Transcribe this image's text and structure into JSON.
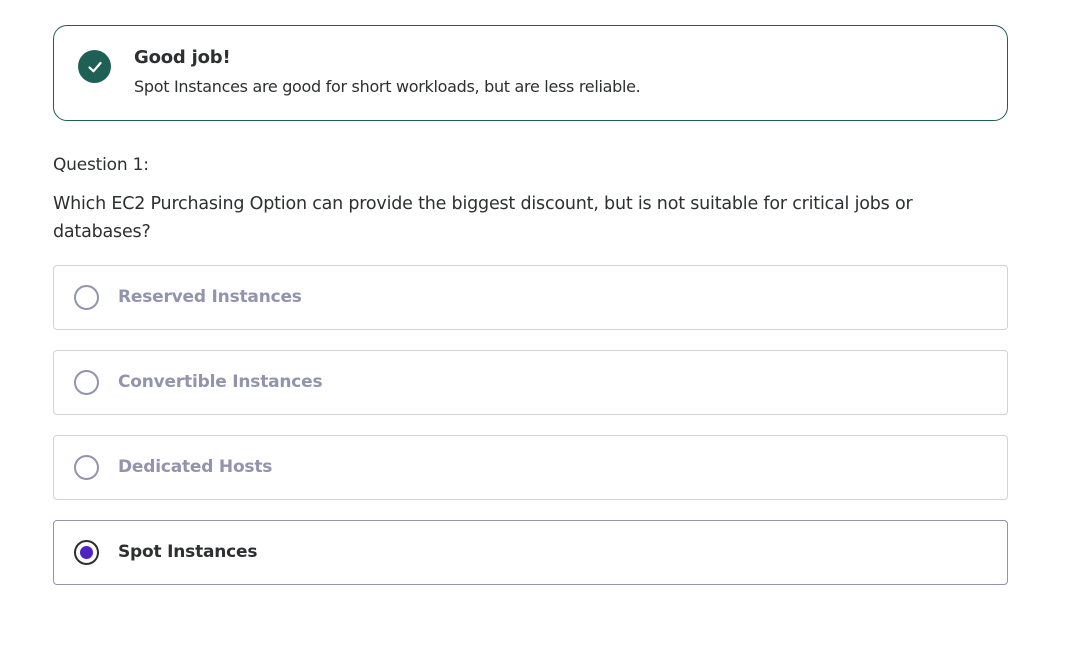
{
  "feedback": {
    "title": "Good job!",
    "message": "Spot Instances are good for short workloads, but are less reliable.",
    "icon": "check-circle-icon",
    "color": "#1e6055"
  },
  "question": {
    "number_label": "Question 1:",
    "text": "Which EC2 Purchasing Option can provide the biggest discount, but is not suitable for critical jobs or databases?"
  },
  "options": [
    {
      "label": "Reserved Instances",
      "selected": false
    },
    {
      "label": "Convertible Instances",
      "selected": false
    },
    {
      "label": "Dedicated Hosts",
      "selected": false
    },
    {
      "label": "Spot Instances",
      "selected": true
    }
  ],
  "colors": {
    "selected_radio": "#5022c3",
    "muted_text": "#9194ac",
    "text": "#2d2f31"
  }
}
